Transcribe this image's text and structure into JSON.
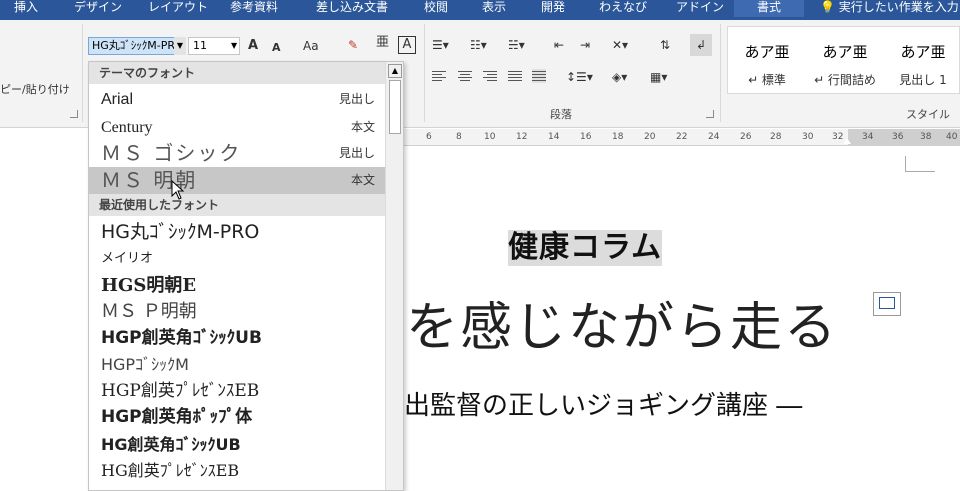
{
  "tabs": [
    {
      "label": "挿入"
    },
    {
      "label": "デザイン"
    },
    {
      "label": "レイアウト"
    },
    {
      "label": "参考資料"
    },
    {
      "label": "差し込み文書"
    },
    {
      "label": "校閲"
    },
    {
      "label": "表示"
    },
    {
      "label": "開発"
    },
    {
      "label": "わえなび"
    },
    {
      "label": "アドイン"
    },
    {
      "label": "書式"
    }
  ],
  "tell_me": "実行したい作業を入力",
  "clipboard": {
    "paste_label": "ピー/貼り付け"
  },
  "font": {
    "name": "HG丸ｺﾞｼｯｸM-PRO",
    "size": "11",
    "grow": "A",
    "shrink": "A",
    "case": "Aa",
    "clear_icon": "eraser-icon",
    "furigana": "亜",
    "border_char": "A"
  },
  "paragraph": {
    "label": "段落"
  },
  "styles": {
    "label": "スタイル",
    "items": [
      {
        "sample": "あア亜",
        "name": "↵ 標準"
      },
      {
        "sample": "あア亜",
        "name": "↵ 行間詰め"
      },
      {
        "sample": "あア亜",
        "name": "見出し 1"
      }
    ]
  },
  "ruler": {
    "ticks": [
      "6",
      "8",
      "10",
      "12",
      "14",
      "16",
      "18",
      "20",
      "22",
      "24",
      "26",
      "28",
      "30",
      "32",
      "34",
      "36",
      "38",
      "40"
    ]
  },
  "dropdown": {
    "theme_header": "テーマのフォント",
    "theme_fonts": [
      {
        "name": "Arial",
        "type": "見出し"
      },
      {
        "name": "Century",
        "type": "本文"
      },
      {
        "name": "ＭＳ ゴシック",
        "type": "見出し"
      },
      {
        "name": "ＭＳ 明朝",
        "type": "本文"
      }
    ],
    "recent_header": "最近使用したフォント",
    "recent_fonts": [
      {
        "name": "HG丸ｺﾞｼｯｸM-PRO"
      },
      {
        "name": "メイリオ"
      },
      {
        "name": "HGS明朝E"
      },
      {
        "name": "ＭＳ Ｐ明朝"
      },
      {
        "name": "HGP創英角ｺﾞｼｯｸUB"
      },
      {
        "name": "HGPｺﾞｼｯｸM"
      },
      {
        "name": "HGP創英ﾌﾟﾚｾﾞﾝｽEB"
      },
      {
        "name": "HGP創英角ﾎﾟｯﾌﾟ体"
      },
      {
        "name": "HG創英角ｺﾞｼｯｸUB"
      },
      {
        "name": "HG創英ﾌﾟﾚｾﾞﾝｽEB"
      }
    ]
  },
  "document": {
    "heading": "健康コラム",
    "title": "を感じながら走る",
    "subtitle": "出監督の正しいジョギング講座 ―"
  }
}
